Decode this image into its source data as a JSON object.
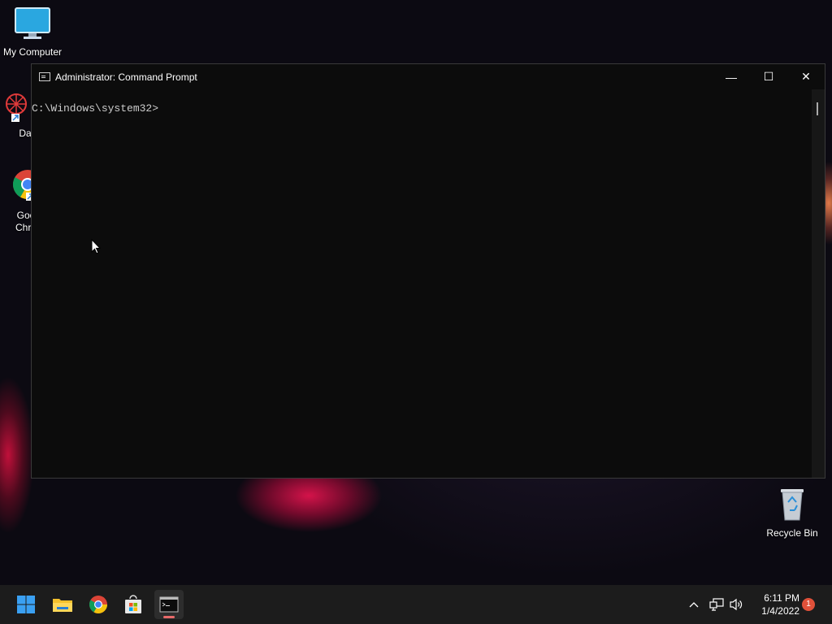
{
  "desktop": {
    "icons": [
      {
        "label": "My Computer",
        "icon": "monitor-icon"
      },
      {
        "label": "DataW",
        "icon": "datawrapper-icon"
      },
      {
        "label": "Goo Chro",
        "icon": "chrome-icon"
      },
      {
        "label": "Recycle Bin",
        "icon": "recycle-bin-icon"
      }
    ]
  },
  "window": {
    "title": "Administrator: Command Prompt",
    "minimize": "—",
    "maximize": "☐",
    "close": "✕",
    "console_text": "C:\\Windows\\system32>"
  },
  "taskbar": {
    "apps": [
      "start-icon",
      "file-explorer-icon",
      "chrome-icon",
      "store-icon",
      "terminal-icon"
    ],
    "tray": {
      "chevron": "^",
      "time": "6:11 PM",
      "date": "1/4/2022",
      "notifications": "1"
    }
  },
  "colors": {
    "console_bg": "#0c0c0c",
    "console_text": "#cccccc",
    "taskbar_bg": "#1c1c1c",
    "accent_underline": "#e86a6a",
    "notification_badge": "#e0513a"
  }
}
